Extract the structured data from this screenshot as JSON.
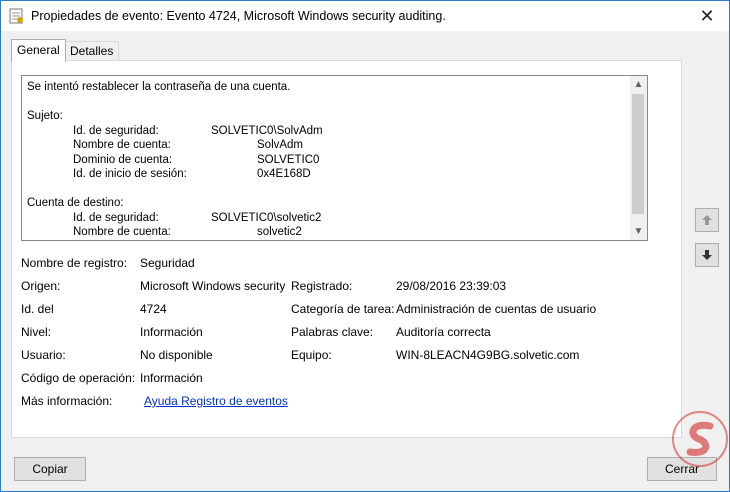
{
  "window": {
    "title": "Propiedades de evento: Evento 4724, Microsoft Windows security auditing.",
    "close_label": "✕"
  },
  "tabs": [
    {
      "label": "General",
      "active": true
    },
    {
      "label": "Detalles",
      "active": false
    }
  ],
  "description": {
    "text": "Se intentó restablecer la contraseña de una cuenta.\n\nSujeto:\n\tId. de seguridad:\t\tSOLVETIC0\\SolvAdm\n\tNombre de cuenta:\t\tSolvAdm\n\tDominio de cuenta:\t\tSOLVETIC0\n\tId. de inicio de sesión:\t\t0x4E168D\n\nCuenta de destino:\n\tId. de seguridad:\t\tSOLVETIC0\\solvetic2\n\tNombre de cuenta:\t\tsolvetic2"
  },
  "properties": {
    "log_name_label": "Nombre de registro:",
    "log_name_value": "Seguridad",
    "source_label": "Origen:",
    "source_value": "Microsoft Windows security",
    "logged_label": "Registrado:",
    "logged_value": "29/08/2016 23:39:03",
    "event_id_label": "Id. del",
    "event_id_value": "4724",
    "task_category_label": "Categoría de tarea:",
    "task_category_value": "Administración de cuentas de usuario",
    "level_label": "Nivel:",
    "level_value": "Información",
    "keywords_label": "Palabras clave:",
    "keywords_value": "Auditoría correcta",
    "user_label": "Usuario:",
    "user_value": "No disponible",
    "computer_label": "Equipo:",
    "computer_value": "WIN-8LEACN4G9BG.solvetic.com",
    "opcode_label": "Código de operación:",
    "opcode_value": "Información",
    "more_info_label": "Más información:",
    "more_info_link": "Ayuda Registro de eventos"
  },
  "buttons": {
    "copy": "Copiar",
    "close": "Cerrar"
  },
  "icons": {
    "title": "event-properties-icon",
    "up": "arrow-up-icon",
    "down": "arrow-down-icon",
    "logo": "solvetic-logo"
  },
  "colors": {
    "window_border": "#2b7bd0",
    "link": "#0033cc",
    "logo_red": "#d42a2a"
  }
}
